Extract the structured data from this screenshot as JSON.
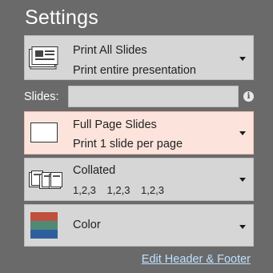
{
  "title": "Settings",
  "slides_dropdown": {
    "line1": "Print All Slides",
    "line2": "Print entire presentation",
    "icon": "slides-stack-icon"
  },
  "slides_field": {
    "label": "Slides:",
    "value": "",
    "info_icon": "info-icon"
  },
  "layout_dropdown": {
    "line1": "Full Page Slides",
    "line2": "Print 1 slide per page",
    "icon": "full-page-slide-icon"
  },
  "collate_dropdown": {
    "line1": "Collated",
    "line2": "1,2,3 1,2,3 1,2,3",
    "icon": "collated-pages-icon"
  },
  "color_dropdown": {
    "line1": "Color",
    "icon": "color-swatch-icon",
    "swatch_colors": [
      "#c0503c",
      "#4f8a76",
      "#2f5e9e"
    ]
  },
  "footer_link": "Edit Header & Footer",
  "colors": {
    "background": "#6a6a6a",
    "selected_bg": "#fce4dc",
    "link": "#bfe0ff"
  }
}
